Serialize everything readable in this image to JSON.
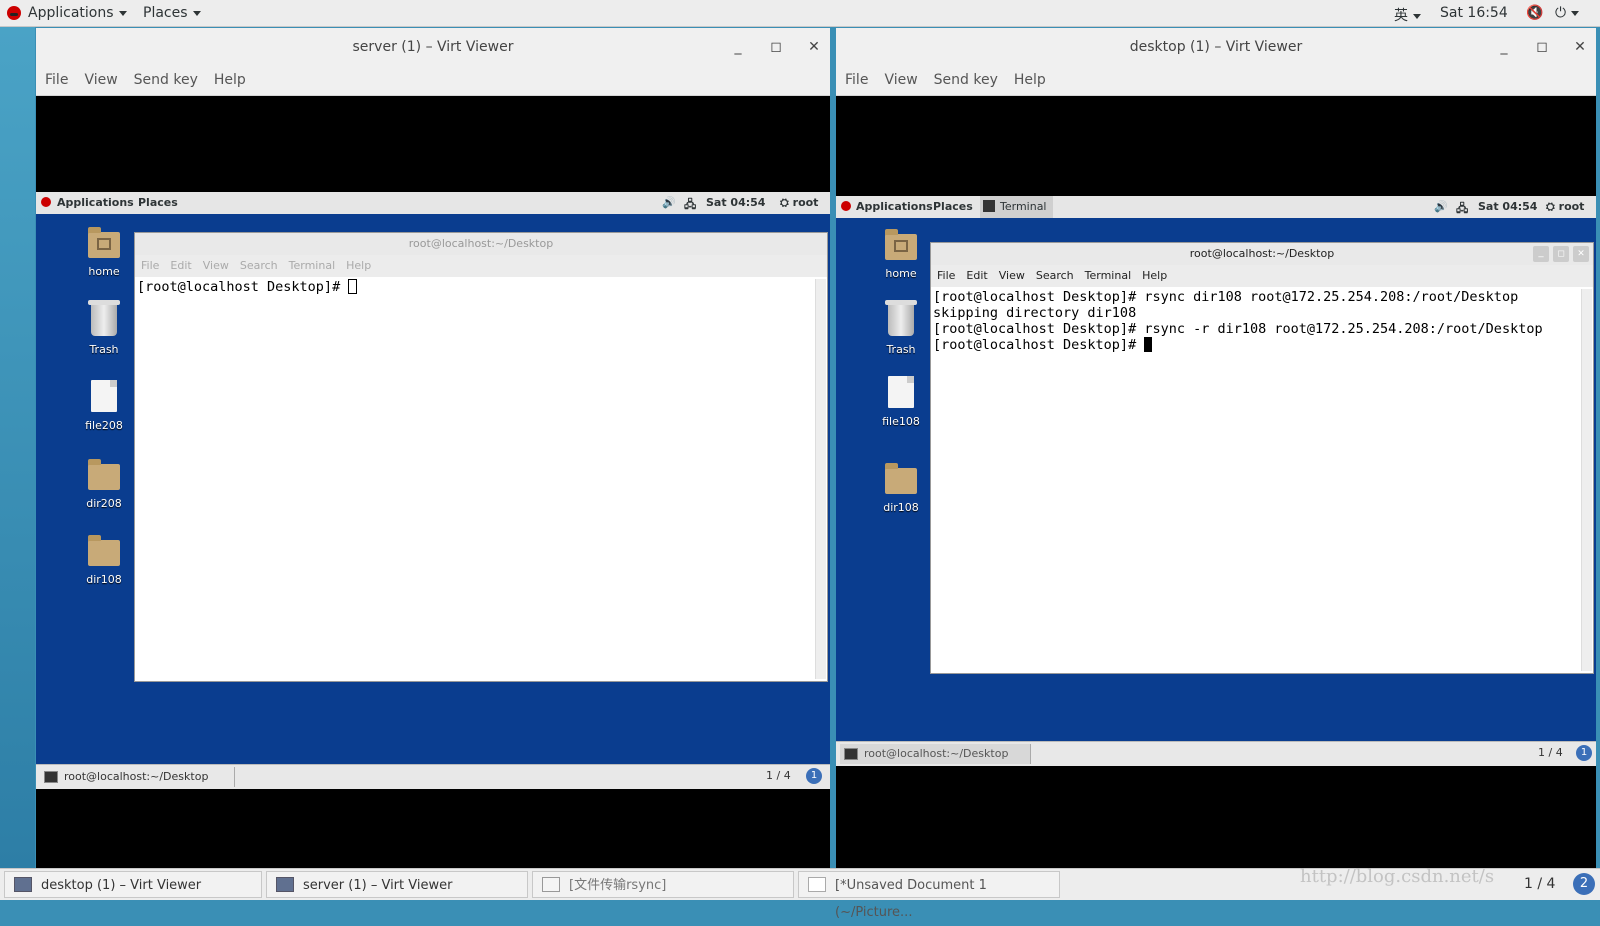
{
  "host": {
    "topbar": {
      "applications": "Applications",
      "places": "Places",
      "input_method": "英",
      "clock": "Sat 16:54"
    },
    "taskbar": [
      {
        "label": "desktop (1) – Virt Viewer"
      },
      {
        "label": "server (1) – Virt Viewer"
      },
      {
        "label": "[文件传输rsync]"
      },
      {
        "label": "[*Unsaved Document 1 (~/Picture..."
      }
    ],
    "pager": "1 / 4",
    "pager_badge": "2",
    "watermark": "http://blog.csdn.net/s"
  },
  "server_window": {
    "title": "server (1) – Virt Viewer",
    "menu": [
      "File",
      "View",
      "Send key",
      "Help"
    ],
    "guest": {
      "topbar": {
        "applications": "Applications",
        "places": "Places",
        "clock": "Sat 04:54",
        "user": "root"
      },
      "icons": [
        "home",
        "Trash",
        "file208",
        "dir208",
        "dir108"
      ],
      "terminal": {
        "title": "root@localhost:~/Desktop",
        "menu": [
          "File",
          "Edit",
          "View",
          "Search",
          "Terminal",
          "Help"
        ],
        "prompt": "[root@localhost Desktop]# "
      },
      "taskbar_item": "root@localhost:~/Desktop",
      "pager": "1 / 4",
      "pager_badge": "1"
    }
  },
  "desktop_window": {
    "title": "desktop (1) – Virt Viewer",
    "menu": [
      "File",
      "View",
      "Send key",
      "Help"
    ],
    "guest": {
      "topbar": {
        "applications": "Applications",
        "places": "Places",
        "terminal_tab": "Terminal",
        "clock": "Sat 04:54",
        "user": "root"
      },
      "icons": [
        "home",
        "Trash",
        "file108",
        "dir108"
      ],
      "terminal": {
        "title": "root@localhost:~/Desktop",
        "menu": [
          "File",
          "Edit",
          "View",
          "Search",
          "Terminal",
          "Help"
        ],
        "lines": [
          "[root@localhost Desktop]# rsync dir108 root@172.25.254.208:/root/Desktop",
          "skipping directory dir108",
          "[root@localhost Desktop]# rsync -r dir108 root@172.25.254.208:/root/Desktop"
        ],
        "prompt": "[root@localhost Desktop]# "
      },
      "taskbar_item": "root@localhost:~/Desktop",
      "pager": "1 / 4",
      "pager_badge": "1"
    }
  }
}
